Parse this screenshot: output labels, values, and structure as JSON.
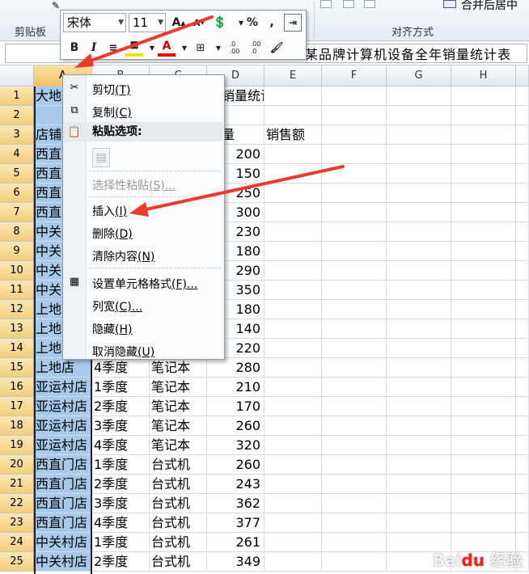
{
  "ribbon": {
    "clipboard_group": "剪贴板",
    "alignment_group": "对齐方式",
    "merge_label": "合并后居中"
  },
  "formula_bar": {
    "content": "某品牌计算机设备全年销量统计表"
  },
  "mini_toolbar": {
    "font": "宋体",
    "size": "11",
    "grow": "A",
    "shrink": "A",
    "percent": "%",
    "comma": ",",
    "bold": "B",
    "italic": "I",
    "dec_inc": ".0\n.00",
    "dec_dec": ".00\n.0"
  },
  "columns": [
    "A",
    "B",
    "C",
    "D",
    "E",
    "F",
    "G",
    "H"
  ],
  "rows": [
    {
      "n": "1",
      "a": "大地",
      "b": "",
      "c": "",
      "d": "年销量统计表",
      "e": ""
    },
    {
      "n": "2",
      "a": "",
      "b": "",
      "c": "",
      "d": "",
      "e": ""
    },
    {
      "n": "3",
      "a": "店铺",
      "b": "",
      "c": "",
      "d": "售量",
      "e": "销售额"
    },
    {
      "n": "4",
      "a": "西直",
      "b": "",
      "c": "",
      "d": "200",
      "e": ""
    },
    {
      "n": "5",
      "a": "西直",
      "b": "",
      "c": "",
      "d": "150",
      "e": ""
    },
    {
      "n": "6",
      "a": "西直",
      "b": "",
      "c": "",
      "d": "250",
      "e": ""
    },
    {
      "n": "7",
      "a": "西直",
      "b": "",
      "c": "",
      "d": "300",
      "e": ""
    },
    {
      "n": "8",
      "a": "中关",
      "b": "",
      "c": "",
      "d": "230",
      "e": ""
    },
    {
      "n": "9",
      "a": "中关",
      "b": "",
      "c": "",
      "d": "180",
      "e": ""
    },
    {
      "n": "10",
      "a": "中关",
      "b": "",
      "c": "",
      "d": "290",
      "e": ""
    },
    {
      "n": "11",
      "a": "中关",
      "b": "",
      "c": "",
      "d": "350",
      "e": ""
    },
    {
      "n": "12",
      "a": "上地",
      "b": "",
      "c": "",
      "d": "180",
      "e": ""
    },
    {
      "n": "13",
      "a": "上地",
      "b": "",
      "c": "",
      "d": "140",
      "e": ""
    },
    {
      "n": "14",
      "a": "上地",
      "b": "",
      "c": "",
      "d": "220",
      "e": ""
    },
    {
      "n": "15",
      "a": "上地店",
      "b": "4季度",
      "c": "笔记本",
      "d": "280",
      "e": ""
    },
    {
      "n": "16",
      "a": "亚运村店",
      "b": "1季度",
      "c": "笔记本",
      "d": "210",
      "e": ""
    },
    {
      "n": "17",
      "a": "亚运村店",
      "b": "2季度",
      "c": "笔记本",
      "d": "170",
      "e": ""
    },
    {
      "n": "18",
      "a": "亚运村店",
      "b": "3季度",
      "c": "笔记本",
      "d": "260",
      "e": ""
    },
    {
      "n": "19",
      "a": "亚运村店",
      "b": "4季度",
      "c": "笔记本",
      "d": "320",
      "e": ""
    },
    {
      "n": "20",
      "a": "西直门店",
      "b": "1季度",
      "c": "台式机",
      "d": "260",
      "e": ""
    },
    {
      "n": "21",
      "a": "西直门店",
      "b": "2季度",
      "c": "台式机",
      "d": "243",
      "e": ""
    },
    {
      "n": "22",
      "a": "西直门店",
      "b": "3季度",
      "c": "台式机",
      "d": "362",
      "e": ""
    },
    {
      "n": "23",
      "a": "西直门店",
      "b": "4季度",
      "c": "台式机",
      "d": "377",
      "e": ""
    },
    {
      "n": "24",
      "a": "中关村店",
      "b": "1季度",
      "c": "台式机",
      "d": "261",
      "e": ""
    },
    {
      "n": "25",
      "a": "中关村店",
      "b": "2季度",
      "c": "台式机",
      "d": "349",
      "e": ""
    }
  ],
  "context_menu": {
    "cut": "剪切",
    "cut_key": "(T)",
    "copy": "复制",
    "copy_key": "(C)",
    "paste_options": "粘贴选项:",
    "paste_special": "选择性粘贴",
    "paste_special_key": "(S)...",
    "insert": "插入",
    "insert_key": "(I)",
    "delete": "删除",
    "delete_key": "(D)",
    "clear": "清除内容",
    "clear_key": "(N)",
    "format_cells": "设置单元格格式",
    "format_cells_key": "(F)...",
    "col_width": "列宽",
    "col_width_key": "(C)...",
    "hide": "隐藏",
    "hide_key": "(H)",
    "unhide": "取消隐藏",
    "unhide_key": "(U)"
  },
  "watermark": "Baidu 经验",
  "colors": {
    "selection": "#a6c9ec",
    "header_selected": "#f1c15f",
    "arrow": "#ee3a2e"
  }
}
